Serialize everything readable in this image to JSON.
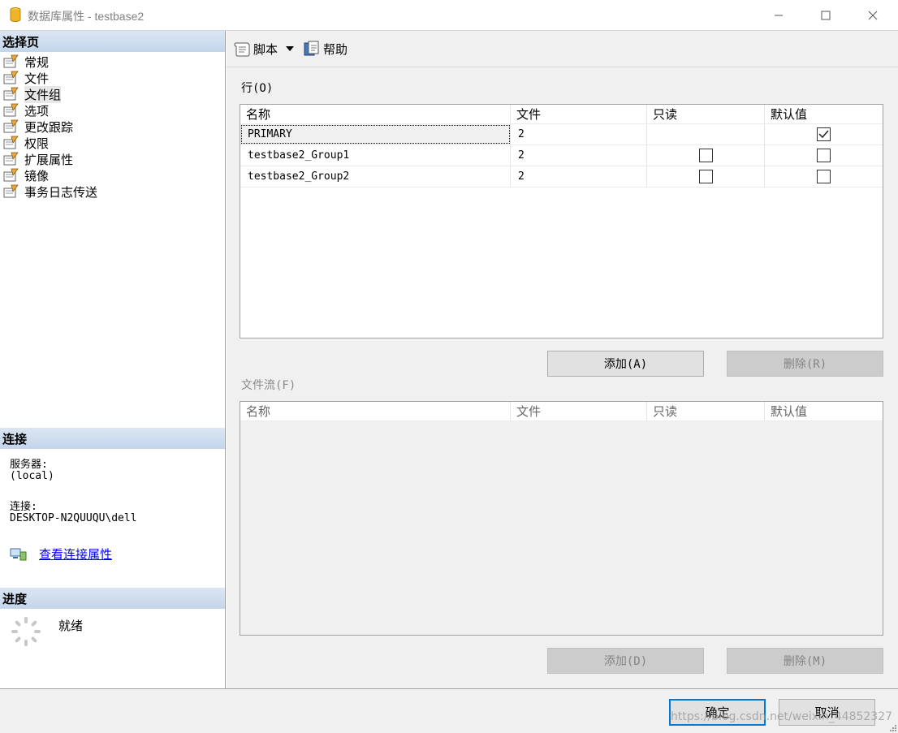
{
  "window": {
    "title": "数据库属性 - testbase2"
  },
  "left": {
    "select_page_header": "选择页",
    "pages": [
      {
        "label": "常规"
      },
      {
        "label": "文件"
      },
      {
        "label": "文件组"
      },
      {
        "label": "选项"
      },
      {
        "label": "更改跟踪"
      },
      {
        "label": "权限"
      },
      {
        "label": "扩展属性"
      },
      {
        "label": "镜像"
      },
      {
        "label": "事务日志传送"
      }
    ],
    "connection_header": "连接",
    "server_label": "服务器:",
    "server_value": "(local)",
    "connection_label": "连接:",
    "connection_value": "DESKTOP-N2QUUQU\\dell",
    "view_connection_link": "查看连接属性",
    "progress_header": "进度",
    "progress_status": "就绪"
  },
  "toolbar": {
    "script_label": "脚本",
    "help_label": "帮助"
  },
  "rows_section": {
    "label": "行(O)",
    "columns": [
      "名称",
      "文件",
      "只读",
      "默认值"
    ],
    "rows": [
      {
        "name": "PRIMARY",
        "files": "2",
        "read_only": null,
        "default": true
      },
      {
        "name": "testbase2_Group1",
        "files": "2",
        "read_only": false,
        "default": false
      },
      {
        "name": "testbase2_Group2",
        "files": "2",
        "read_only": false,
        "default": false
      }
    ],
    "add_button": "添加(A)",
    "remove_button": "删除(R)"
  },
  "filestream_section": {
    "label": "文件流(F)",
    "columns": [
      "名称",
      "文件",
      "只读",
      "默认值"
    ],
    "add_button": "添加(D)",
    "remove_button": "删除(M)"
  },
  "footer": {
    "ok_button": "确定",
    "cancel_button": "取消",
    "watermark": "https://blog.csdn.net/weixin_44852327"
  }
}
